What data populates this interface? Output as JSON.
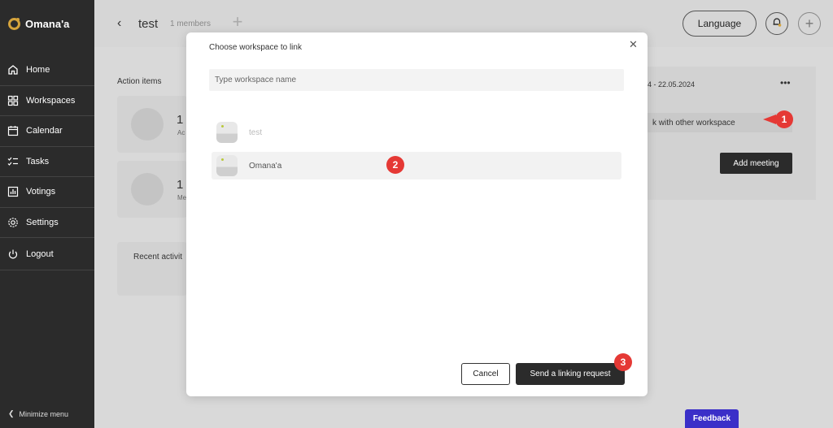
{
  "sidebar": {
    "logo": "Omana'a",
    "items": [
      {
        "label": "Home",
        "icon": "home-icon"
      },
      {
        "label": "Workspaces",
        "icon": "workspaces-icon"
      },
      {
        "label": "Calendar",
        "icon": "calendar-icon"
      },
      {
        "label": "Tasks",
        "icon": "tasks-icon"
      },
      {
        "label": "Votings",
        "icon": "votings-icon"
      },
      {
        "label": "Settings",
        "icon": "gear-icon"
      },
      {
        "label": "Logout",
        "icon": "power-icon"
      }
    ],
    "minimize_label": "Minimize menu"
  },
  "header": {
    "title": "test",
    "members": "1 members",
    "language_label": "Language"
  },
  "background": {
    "action_items_label": "Action items",
    "card1_count": "1",
    "card1_sub": "Ac",
    "card2_count": "1",
    "card2_sub": "Me",
    "recent_label": "Recent activit",
    "date_range": "4 - 22.05.2024",
    "more_label": "•••",
    "link_label": "k with other workspace",
    "add_meeting_label": "Add meeting"
  },
  "modal": {
    "title": "Choose workspace to link",
    "close_label": "✕",
    "search_placeholder": "Type workspace name",
    "workspaces": [
      {
        "name": "test"
      },
      {
        "name": "Omana'a"
      }
    ],
    "cancel_label": "Cancel",
    "send_label": "Send a linking request"
  },
  "badges": [
    "1",
    "2",
    "3"
  ],
  "feedback_label": "Feedback",
  "colors": {
    "accent": "#d4a33c",
    "badge": "#e53935",
    "feedback": "#3a2fc8",
    "sidebar": "#2b2b2b"
  }
}
